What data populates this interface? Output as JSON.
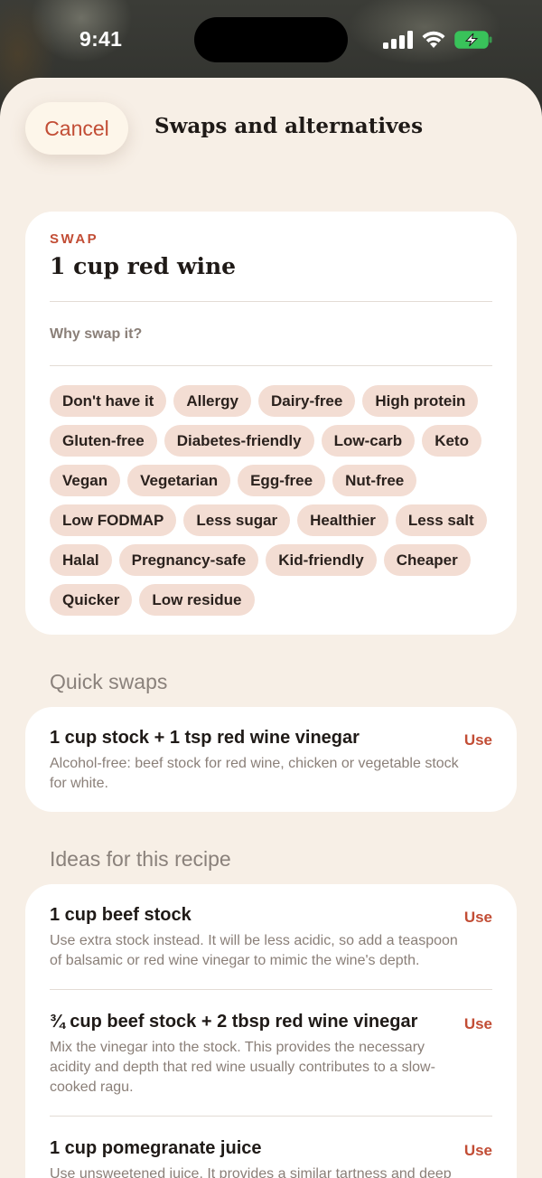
{
  "status_bar": {
    "time": "9:41"
  },
  "header": {
    "cancel_label": "Cancel",
    "title": "Swaps and alternatives"
  },
  "swap": {
    "eyebrow": "SWAP",
    "ingredient": "1 cup red wine",
    "why_label": "Why swap it?",
    "reasons": [
      "Don't have it",
      "Allergy",
      "Dairy-free",
      "High protein",
      "Gluten-free",
      "Diabetes-friendly",
      "Low-carb",
      "Keto",
      "Vegan",
      "Vegetarian",
      "Egg-free",
      "Nut-free",
      "Low FODMAP",
      "Less sugar",
      "Healthier",
      "Less salt",
      "Halal",
      "Pregnancy-safe",
      "Kid-friendly",
      "Cheaper",
      "Quicker",
      "Low residue"
    ]
  },
  "quick_swaps": {
    "label": "Quick swaps",
    "items": [
      {
        "title": "1 cup stock + 1 tsp red wine vinegar",
        "description": "Alcohol-free: beef stock for red wine, chicken or vegetable stock for white.",
        "action": "Use"
      }
    ]
  },
  "ideas": {
    "label": "Ideas for this recipe",
    "items": [
      {
        "title": "1 cup beef stock",
        "description": "Use extra stock instead. It will be less acidic, so add a teaspoon of balsamic or red wine vinegar to mimic the wine's depth.",
        "action": "Use"
      },
      {
        "title": "¾ cup beef stock + 2 tbsp red wine vinegar",
        "description": "Mix the vinegar into the stock. This provides the necessary acidity and depth that red wine usually contributes to a slow-cooked ragu.",
        "action": "Use"
      },
      {
        "title": "1 cup pomegranate juice",
        "description": "Use unsweetened juice. It provides a similar tartness and deep",
        "action": "Use"
      }
    ]
  },
  "colors": {
    "accent": "#c24d35",
    "sheet_bg": "#f7efe6",
    "chip_bg": "#f3ddd3"
  }
}
